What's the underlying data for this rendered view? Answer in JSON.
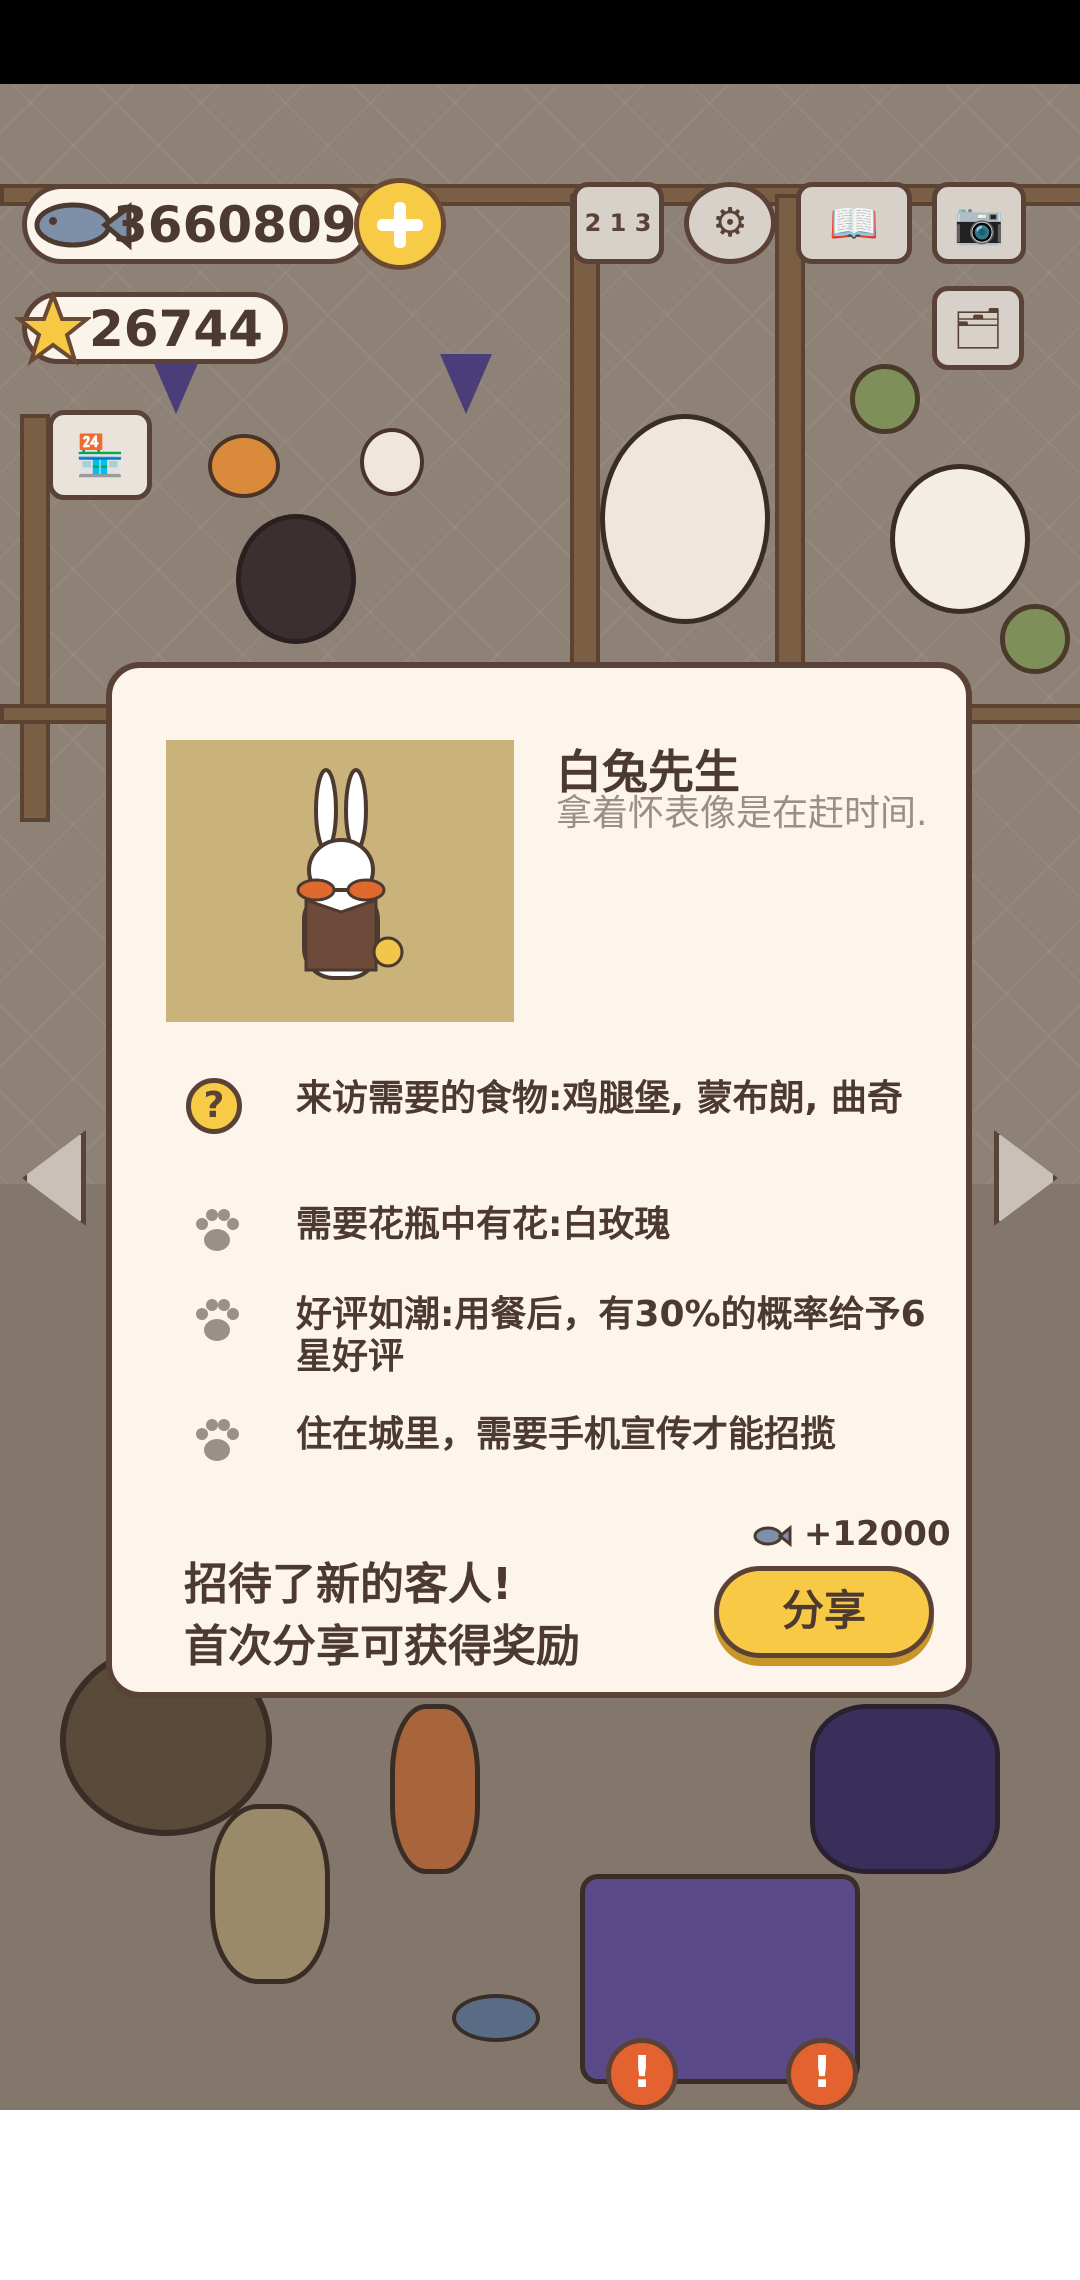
{
  "currency": {
    "fish": "3660809",
    "stars": "26744"
  },
  "hud": {
    "icons": [
      "leaderboard-icon",
      "settings-icon",
      "cat-book-icon",
      "camera-icon",
      "postcard-icon",
      "shop-icon"
    ],
    "leaderboard_label": "2 1 3"
  },
  "dialog": {
    "name": "白兔先生",
    "description": "拿着怀表像是在赶时间.",
    "requirements": [
      {
        "icon": "question-icon",
        "text": "来访需要的食物:鸡腿堡, 蒙布朗, 曲奇"
      },
      {
        "icon": "paw-icon",
        "text": "需要花瓶中有花:白玫瑰"
      },
      {
        "icon": "paw-icon",
        "text": "好评如潮:用餐后，有30%的概率给予6星好评"
      },
      {
        "icon": "paw-icon",
        "text": "住在城里，需要手机宣传才能招揽"
      }
    ],
    "question_mark": "?",
    "reward": "+12000",
    "prompt_line1": "招待了新的客人!",
    "prompt_line2": "首次分享可获得奖励",
    "share_label": "分享"
  },
  "badges": {
    "alert": "!"
  },
  "colors": {
    "accent_yellow": "#f8c944",
    "dialog_bg": "#fdf5ec",
    "outline": "#5b4236",
    "portrait_bg": "#c9b37a"
  }
}
